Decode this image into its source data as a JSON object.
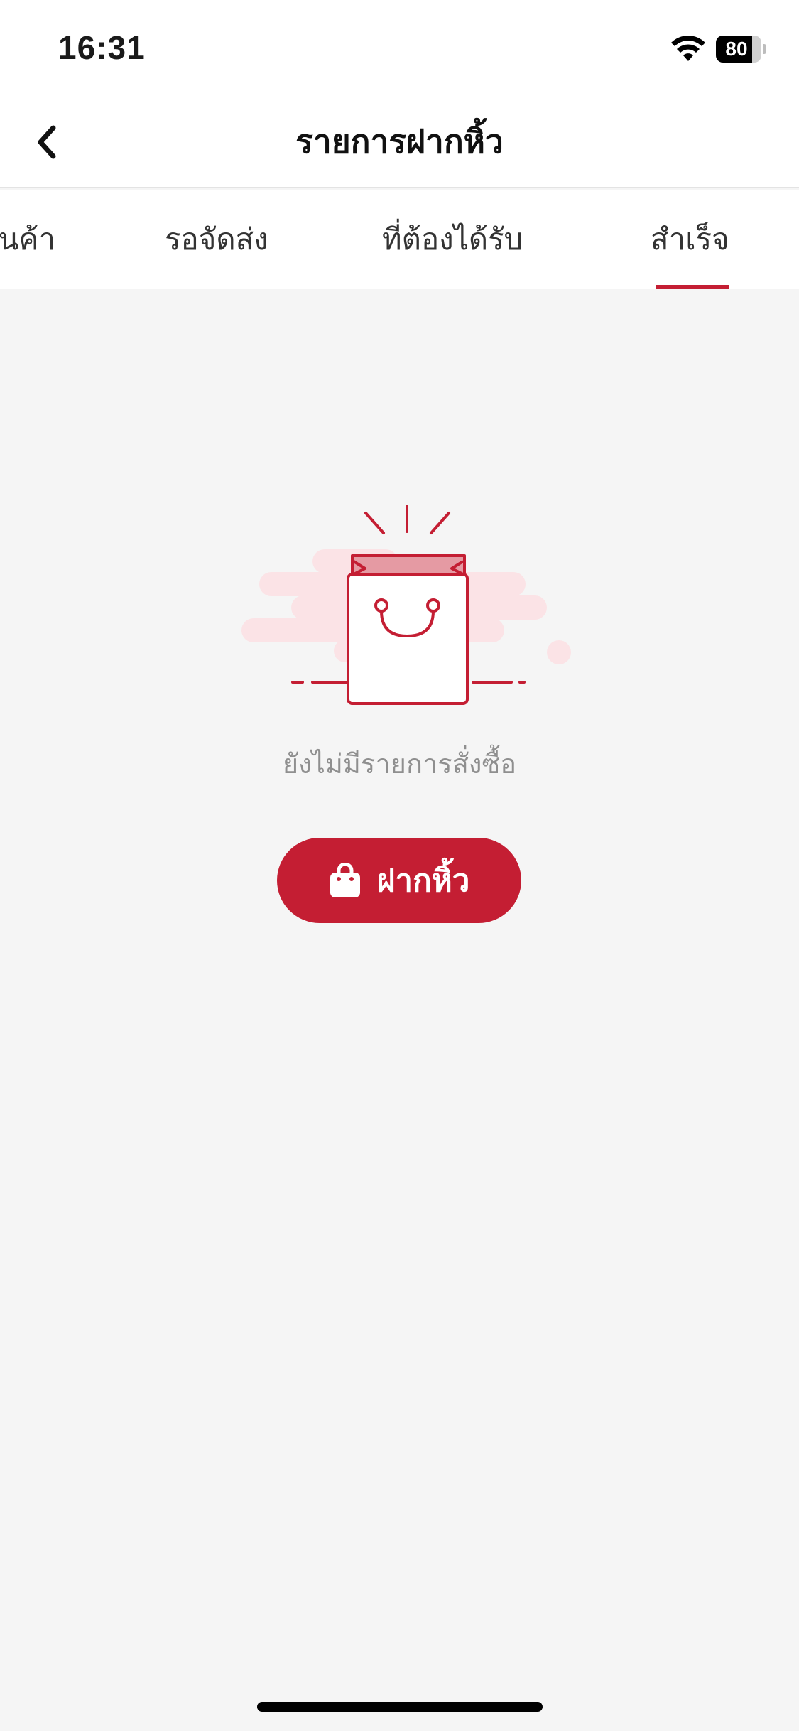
{
  "status_bar": {
    "time": "16:31",
    "battery_level": "80",
    "battery_fraction": 0.8,
    "wifi_icon": "wifi-icon"
  },
  "nav": {
    "title": "รายการฝากหิ้ว",
    "back_icon": "chevron-left-icon"
  },
  "tabs": [
    {
      "label": "สินค้า",
      "active": false
    },
    {
      "label": "รอจัดส่ง",
      "active": false
    },
    {
      "label": "ที่ต้องได้รับ",
      "active": false
    },
    {
      "label": "สำเร็จ",
      "active": true
    }
  ],
  "empty_state": {
    "icon": "shopping-bag-illustration",
    "message": "ยังไม่มีรายการสั่งซื้อ"
  },
  "action": {
    "label": "ฝากหิ้ว",
    "icon": "shopping-bag-icon"
  },
  "colors": {
    "accent": "#c41e33",
    "background": "#f5f5f5",
    "muted_text": "#8f8f8f"
  }
}
